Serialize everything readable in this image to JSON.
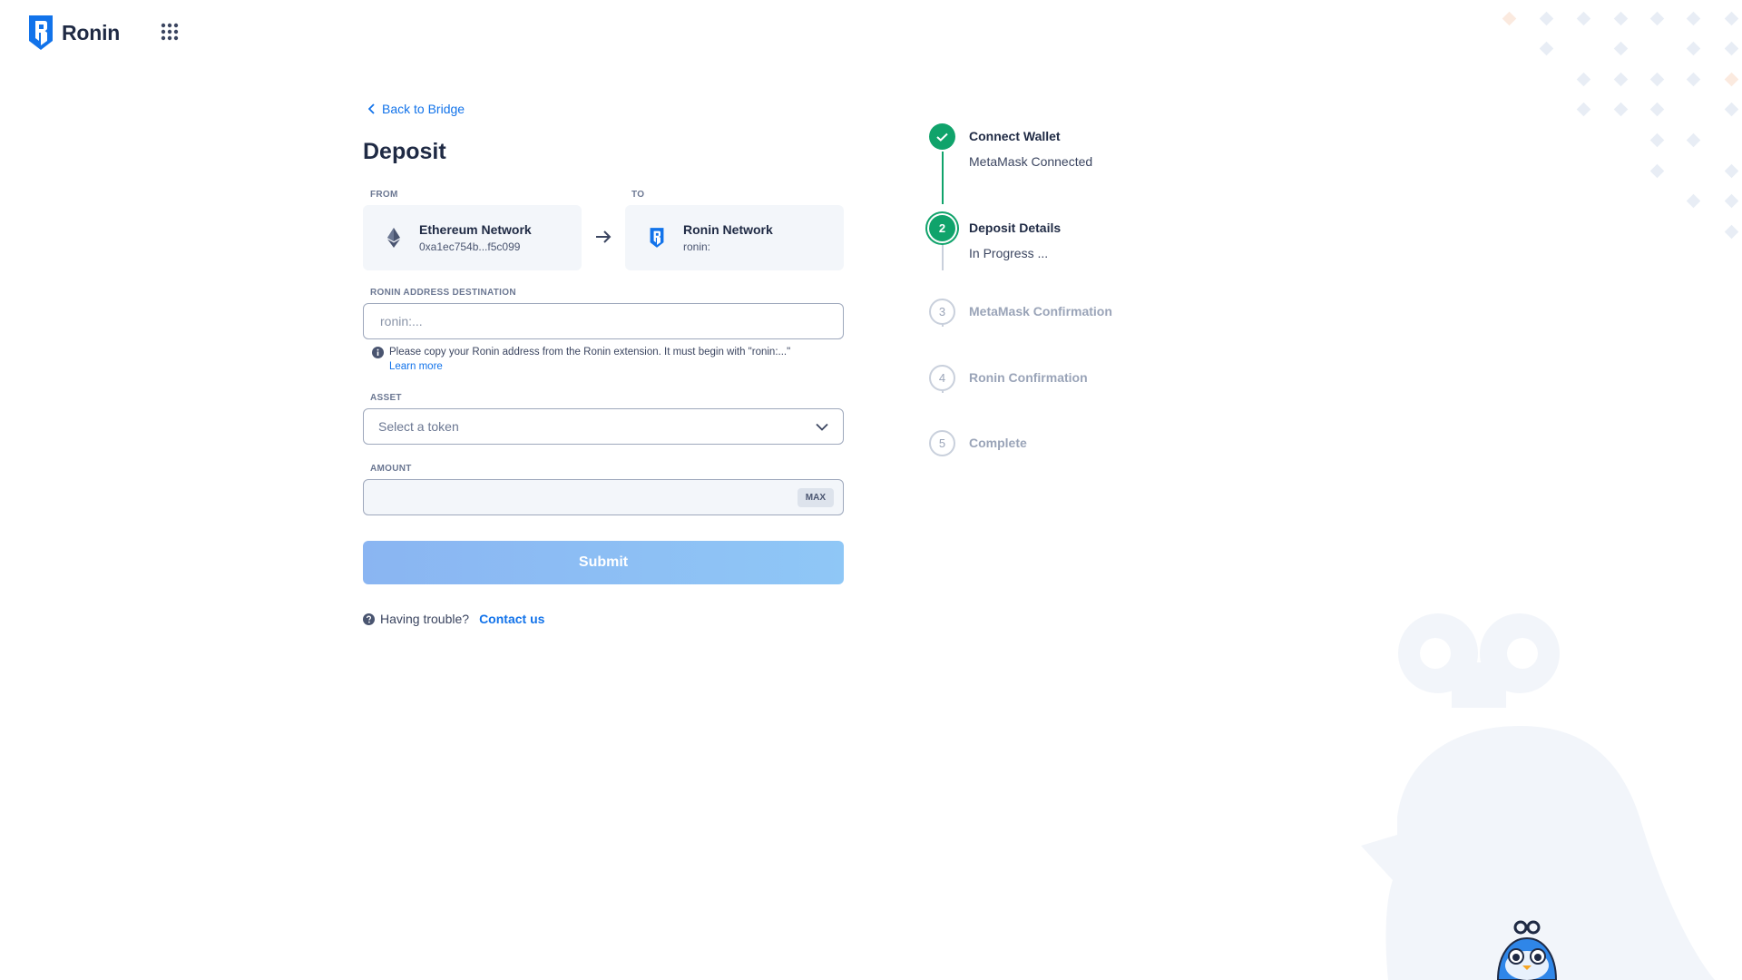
{
  "header": {
    "app_name": "Ronin",
    "logo_icon": "ronin-shield-icon",
    "apps_icon": "grid-dots-icon"
  },
  "form": {
    "back_label": "Back to Bridge",
    "title": "Deposit",
    "from_label": "FROM",
    "to_label": "TO",
    "from": {
      "name": "Ethereum Network",
      "address": "0xa1ec754b...f5c099",
      "icon": "ethereum-icon"
    },
    "to": {
      "name": "Ronin Network",
      "address": "ronin:",
      "icon": "ronin-shield-icon"
    },
    "destination_label": "RONIN ADDRESS DESTINATION",
    "destination_placeholder": "ronin:...",
    "destination_hint": "Please copy your Ronin address from the Ronin extension. It must begin with \"ronin:...\"",
    "learn_more": "Learn more",
    "asset_label": "ASSET",
    "asset_placeholder": "Select a token",
    "amount_label": "AMOUNT",
    "amount_value": "",
    "max_label": "MAX",
    "submit_label": "Submit",
    "trouble_text": "Having trouble?",
    "contact_label": "Contact us"
  },
  "steps": [
    {
      "number": "1",
      "title": "Connect Wallet",
      "subtitle": "MetaMask Connected",
      "status": "done"
    },
    {
      "number": "2",
      "title": "Deposit Details",
      "subtitle": "In Progress ...",
      "status": "active"
    },
    {
      "number": "3",
      "title": "MetaMask Confirmation",
      "subtitle": "",
      "status": "pending"
    },
    {
      "number": "4",
      "title": "Ronin Confirmation",
      "subtitle": "",
      "status": "pending"
    },
    {
      "number": "5",
      "title": "Complete",
      "subtitle": "",
      "status": "pending"
    }
  ],
  "colors": {
    "brand_blue": "#1273ea",
    "success_green": "#10a36b",
    "text_dark": "#1f2a44",
    "muted": "#9aa4b8",
    "submit_gradient_start": "#8ab5f2",
    "submit_gradient_end": "#8fc7f6"
  }
}
